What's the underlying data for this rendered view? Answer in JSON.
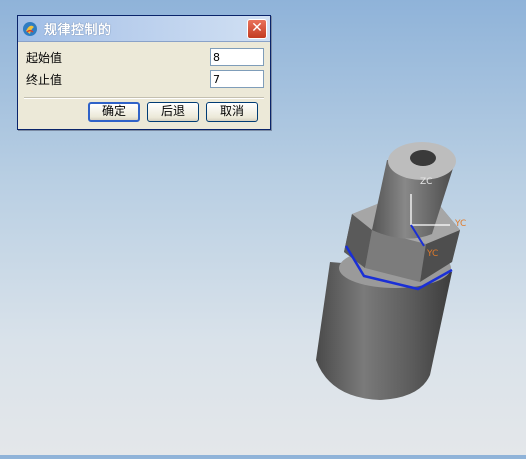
{
  "dialog": {
    "title": "规律控制的",
    "close_glyph": "✕",
    "start_label": "起始值",
    "start_value": "8",
    "end_label": "终止值",
    "end_value": "7",
    "ok_label": "确定",
    "back_label": "后退",
    "cancel_label": "取消"
  },
  "viewport": {
    "axis_z": "ZC",
    "axis_x": "YC",
    "axis_y": "YC",
    "background_top": "#8fb3d9",
    "background_bottom": "#e4e7ea",
    "curve_color": "#1a2fd6",
    "axis_label_color": "#e07a2a"
  }
}
